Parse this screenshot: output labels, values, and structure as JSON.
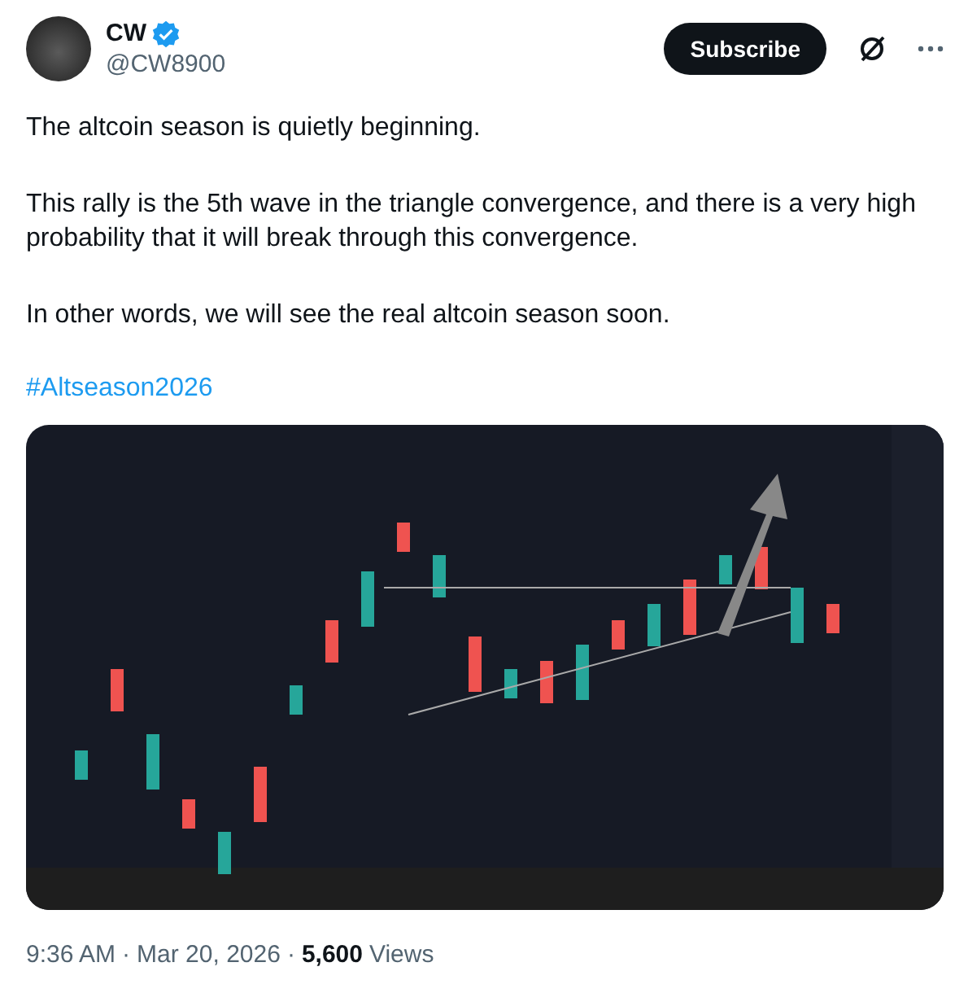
{
  "author": {
    "name": "CW",
    "verified": true,
    "handle": "@CW8900"
  },
  "subscribe_button": "Subscribe",
  "paragraphs": [
    "The altcoin season is quietly beginning.",
    "This rally is the 5th wave in the triangle convergence, and there is a very high probability that it will break through this convergence.",
    "In other words, we will see the real altcoin season soon."
  ],
  "hashtag": "#Altseason2026",
  "footer": {
    "time": "9:36 AM",
    "separator_1": "·",
    "date": "Mar 20, 2026",
    "separator_2": "·",
    "views_count": "5,600",
    "views_label": "Views"
  }
}
